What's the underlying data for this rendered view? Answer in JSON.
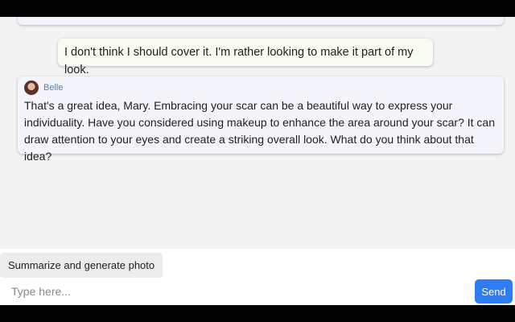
{
  "messages": [
    {
      "role": "user",
      "text": "I don't think I should cover it. I'm rather looking to make it part of my look."
    },
    {
      "role": "assistant",
      "sender": "Belle",
      "text": "That's a great idea, Mary. Embracing your scar can be a beautiful way to express your individuality. Have you considered using makeup to enhance the area around your scar? It can draw attention to your eyes and create a striking overall look. What do you think about that idea?"
    }
  ],
  "composer": {
    "suggestion_label": "Summarize and generate photo",
    "input_placeholder": "Type here...",
    "input_value": "",
    "send_label": "Send"
  },
  "colors": {
    "send_button": "#2f7bf0",
    "assistant_bubble": "#f4f4fb",
    "user_bubble": "#f8fbf1",
    "chat_background": "#f3f3f3"
  }
}
